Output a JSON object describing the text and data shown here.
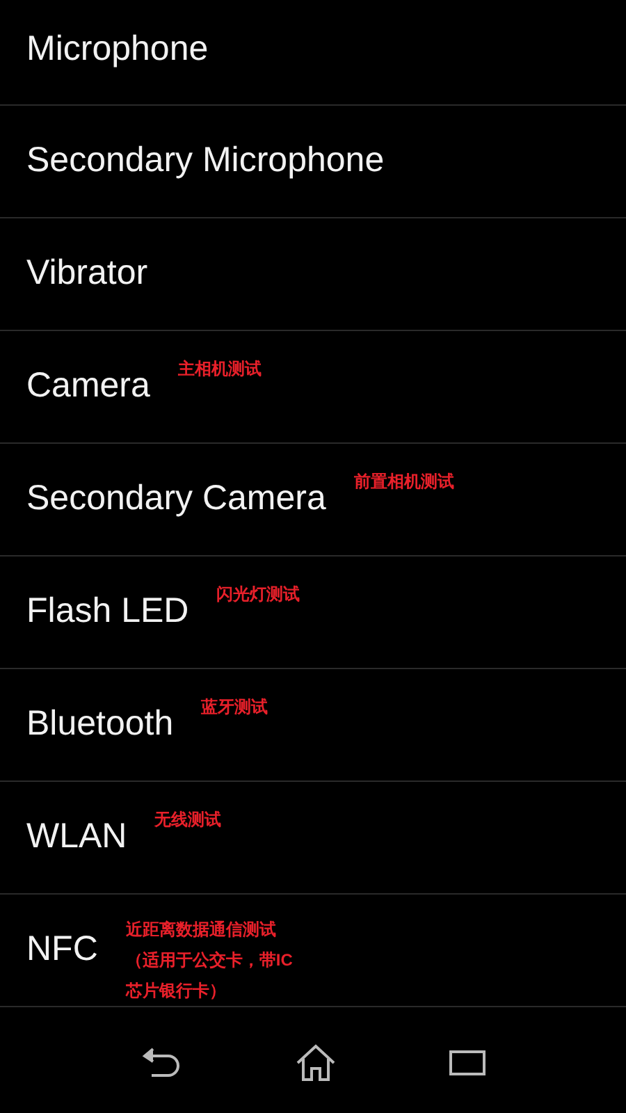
{
  "items": [
    {
      "label": "Microphone"
    },
    {
      "label": "Secondary Microphone"
    },
    {
      "label": "Vibrator"
    },
    {
      "label": "Camera",
      "note": "主相机测试"
    },
    {
      "label": "Secondary Camera",
      "note": "前置相机测试"
    },
    {
      "label": "Flash LED",
      "note": "闪光灯测试"
    },
    {
      "label": "Bluetooth",
      "note": "蓝牙测试"
    },
    {
      "label": "WLAN",
      "note": "无线测试"
    },
    {
      "label": "NFC",
      "note": "近距离数据通信测试（适用于公交卡，带IC芯片银行卡）"
    }
  ]
}
